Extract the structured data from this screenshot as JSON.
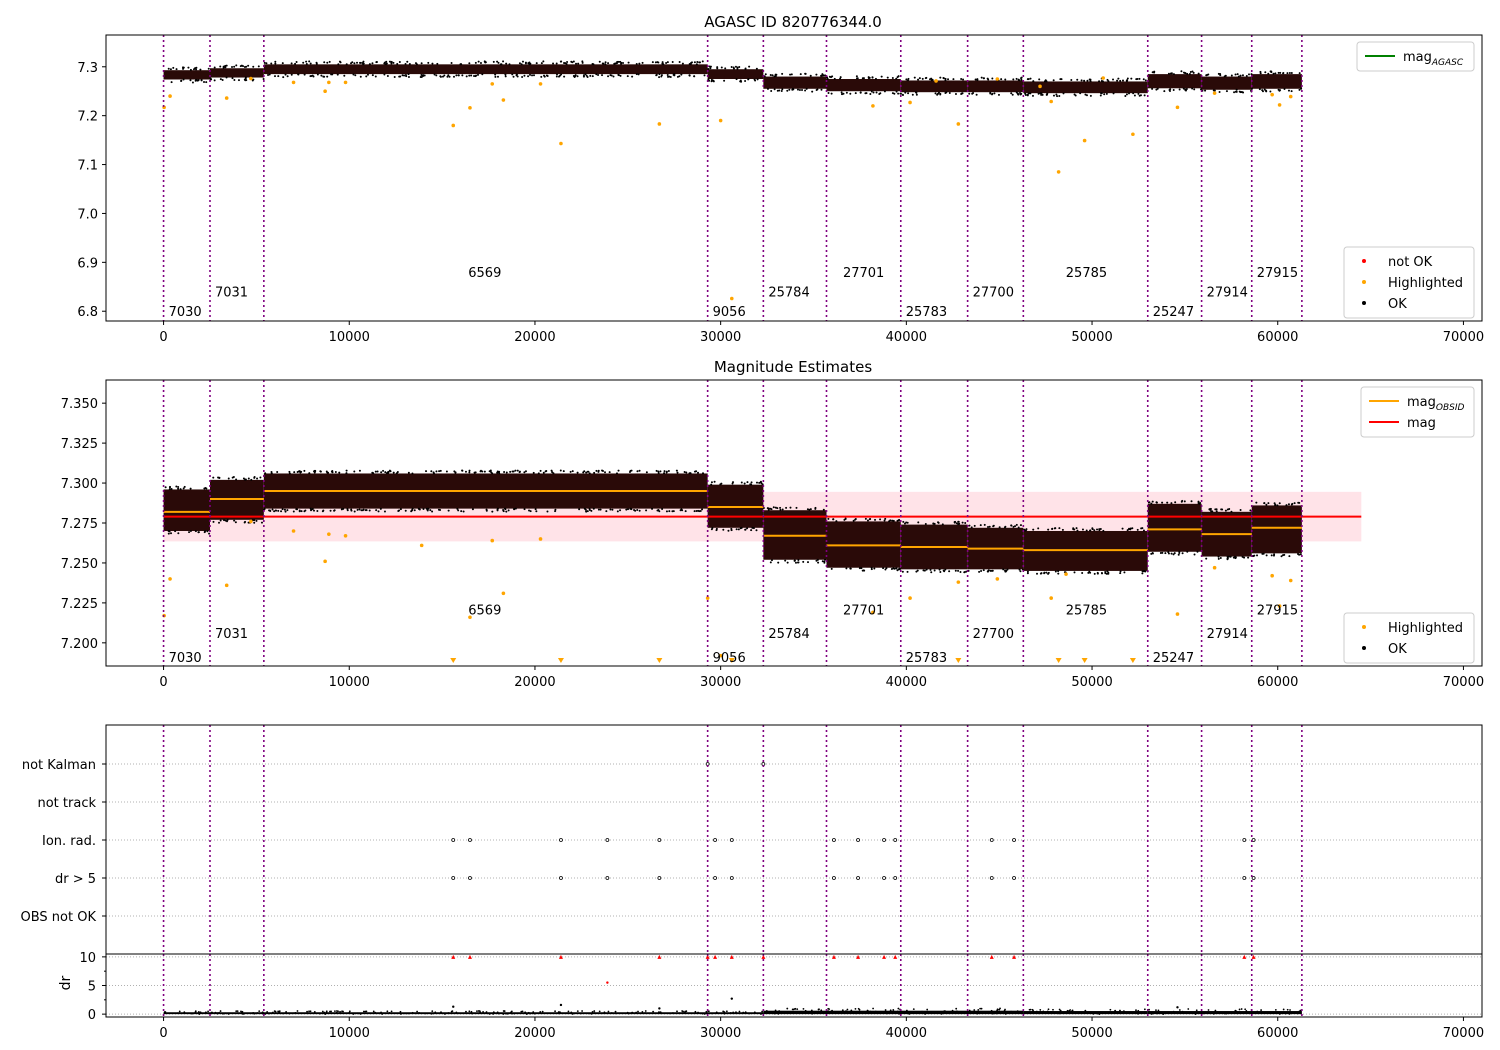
{
  "colors": {
    "ok": "#000000",
    "highlighted": "#ffa500",
    "not_ok": "#ff0000",
    "mag_agasc": "#008000",
    "mag_obsid": "#ffa500",
    "mag": "#ff0000",
    "band": "#ffc0cb",
    "obs_boundary": "#800080",
    "ok_band_fill": "#2a0a08"
  },
  "obsids": [
    {
      "label": "7030",
      "start": 0,
      "end": 2500,
      "level": 0
    },
    {
      "label": "7031",
      "start": 2500,
      "end": 5400,
      "level": 1
    },
    {
      "label": "6569",
      "start": 5400,
      "end": 29300,
      "level": 2
    },
    {
      "label": "9056",
      "start": 29300,
      "end": 32300,
      "level": 0
    },
    {
      "label": "25784",
      "start": 32300,
      "end": 35700,
      "level": 1
    },
    {
      "label": "27701",
      "start": 35700,
      "end": 39700,
      "level": 2
    },
    {
      "label": "25783",
      "start": 39700,
      "end": 43300,
      "level": 0
    },
    {
      "label": "27700",
      "start": 43300,
      "end": 46300,
      "level": 1
    },
    {
      "label": "25785",
      "start": 46300,
      "end": 53000,
      "level": 2
    },
    {
      "label": "25247",
      "start": 53000,
      "end": 55900,
      "level": 0
    },
    {
      "label": "27914",
      "start": 55900,
      "end": 58600,
      "level": 1
    },
    {
      "label": "27915",
      "start": 58600,
      "end": 61300,
      "level": 2
    }
  ],
  "chart_data": [
    {
      "type": "scatter",
      "title": "AGASC ID 820776344.0",
      "xlim": [
        -3100,
        71000
      ],
      "ylim": [
        6.78,
        7.365
      ],
      "xticks": [
        0,
        10000,
        20000,
        30000,
        40000,
        50000,
        60000,
        70000
      ],
      "xtick_labels": [
        "0",
        "10000",
        "20000",
        "30000",
        "40000",
        "50000",
        "60000",
        "70000"
      ],
      "yticks": [
        6.8,
        6.9,
        7.0,
        7.1,
        7.2,
        7.3
      ],
      "ytick_labels": [
        "6.8",
        "6.9",
        "7.0",
        "7.1",
        "7.2",
        "7.3"
      ],
      "ok_band": [
        {
          "start": 0,
          "end": 2500,
          "lo": 7.274,
          "hi": 7.293
        },
        {
          "start": 2500,
          "end": 5400,
          "lo": 7.278,
          "hi": 7.297
        },
        {
          "start": 5400,
          "end": 29300,
          "lo": 7.285,
          "hi": 7.305
        },
        {
          "start": 29300,
          "end": 32300,
          "lo": 7.275,
          "hi": 7.295
        },
        {
          "start": 32300,
          "end": 35700,
          "lo": 7.255,
          "hi": 7.28
        },
        {
          "start": 35700,
          "end": 39700,
          "lo": 7.25,
          "hi": 7.275
        },
        {
          "start": 39700,
          "end": 43300,
          "lo": 7.248,
          "hi": 7.272
        },
        {
          "start": 43300,
          "end": 46300,
          "lo": 7.248,
          "hi": 7.272
        },
        {
          "start": 46300,
          "end": 53000,
          "lo": 7.246,
          "hi": 7.27
        },
        {
          "start": 53000,
          "end": 55900,
          "lo": 7.256,
          "hi": 7.285
        },
        {
          "start": 55900,
          "end": 58600,
          "lo": 7.253,
          "hi": 7.28
        },
        {
          "start": 58600,
          "end": 61300,
          "lo": 7.255,
          "hi": 7.285
        }
      ],
      "highlighted_points": [
        [
          30,
          7.217
        ],
        [
          350,
          7.24
        ],
        [
          3400,
          7.236
        ],
        [
          4700,
          7.276
        ],
        [
          7000,
          7.268
        ],
        [
          8700,
          7.25
        ],
        [
          8900,
          7.268
        ],
        [
          9800,
          7.268
        ],
        [
          15600,
          7.18
        ],
        [
          16500,
          7.216
        ],
        [
          17700,
          7.265
        ],
        [
          18300,
          7.232
        ],
        [
          20300,
          7.265
        ],
        [
          21400,
          7.143
        ],
        [
          26700,
          7.183
        ],
        [
          30000,
          7.19
        ],
        [
          30600,
          6.826
        ],
        [
          38200,
          7.22
        ],
        [
          40200,
          7.227
        ],
        [
          41600,
          7.271
        ],
        [
          42800,
          7.183
        ],
        [
          44900,
          7.275
        ],
        [
          47200,
          7.26
        ],
        [
          47800,
          7.229
        ],
        [
          48200,
          7.085
        ],
        [
          49600,
          7.149
        ],
        [
          50600,
          7.277
        ],
        [
          52200,
          7.162
        ],
        [
          54600,
          7.217
        ],
        [
          56600,
          7.246
        ],
        [
          59700,
          7.243
        ],
        [
          60100,
          7.222
        ],
        [
          60700,
          7.239
        ]
      ],
      "legend_upper": {
        "location": "upper right",
        "entries": [
          {
            "label": "mag",
            "subscript": "AGASC",
            "color": "mag_agasc"
          }
        ]
      },
      "legend_lower": {
        "location": "lower right",
        "entries": [
          {
            "label": "not OK",
            "color": "not_ok"
          },
          {
            "label": "Highlighted",
            "color": "highlighted"
          },
          {
            "label": "OK",
            "color": "ok"
          }
        ]
      },
      "obsid_label_y": [
        6.8,
        6.84,
        6.88
      ]
    },
    {
      "type": "scatter",
      "title": "Magnitude Estimates",
      "xlim": [
        -3100,
        71000
      ],
      "ylim": [
        7.1855,
        7.3645
      ],
      "xticks": [
        0,
        10000,
        20000,
        30000,
        40000,
        50000,
        60000,
        70000
      ],
      "xtick_labels": [
        "0",
        "10000",
        "20000",
        "30000",
        "40000",
        "50000",
        "60000",
        "70000"
      ],
      "yticks": [
        7.2,
        7.225,
        7.25,
        7.275,
        7.3,
        7.325,
        7.35
      ],
      "ytick_labels": [
        "7.200",
        "7.225",
        "7.250",
        "7.275",
        "7.300",
        "7.325",
        "7.350"
      ],
      "mag": 7.279,
      "mag_band": [
        7.2635,
        7.2945
      ],
      "mag_extent": [
        0,
        64500
      ],
      "mag_obsid": [
        7.282,
        7.29,
        7.295,
        7.285,
        7.267,
        7.261,
        7.26,
        7.259,
        7.258,
        7.271,
        7.268,
        7.272
      ],
      "ok_band": [
        {
          "start": 0,
          "end": 2500,
          "lo": 7.27,
          "hi": 7.296
        },
        {
          "start": 2500,
          "end": 5400,
          "lo": 7.277,
          "hi": 7.302
        },
        {
          "start": 5400,
          "end": 29300,
          "lo": 7.284,
          "hi": 7.306
        },
        {
          "start": 29300,
          "end": 32300,
          "lo": 7.272,
          "hi": 7.299
        },
        {
          "start": 32300,
          "end": 35700,
          "lo": 7.252,
          "hi": 7.283
        },
        {
          "start": 35700,
          "end": 39700,
          "lo": 7.247,
          "hi": 7.276
        },
        {
          "start": 39700,
          "end": 43300,
          "lo": 7.246,
          "hi": 7.274
        },
        {
          "start": 43300,
          "end": 46300,
          "lo": 7.246,
          "hi": 7.272
        },
        {
          "start": 46300,
          "end": 53000,
          "lo": 7.245,
          "hi": 7.27
        },
        {
          "start": 53000,
          "end": 55900,
          "lo": 7.257,
          "hi": 7.287
        },
        {
          "start": 55900,
          "end": 58600,
          "lo": 7.254,
          "hi": 7.282
        },
        {
          "start": 58600,
          "end": 61300,
          "lo": 7.256,
          "hi": 7.286
        }
      ],
      "highlighted_points": [
        [
          30,
          7.217
        ],
        [
          350,
          7.24
        ],
        [
          3400,
          7.236
        ],
        [
          4700,
          7.276
        ],
        [
          7000,
          7.27
        ],
        [
          8700,
          7.251
        ],
        [
          8900,
          7.268
        ],
        [
          9800,
          7.267
        ],
        [
          13900,
          7.261
        ],
        [
          16500,
          7.216
        ],
        [
          17700,
          7.264
        ],
        [
          18300,
          7.231
        ],
        [
          20300,
          7.265
        ],
        [
          29300,
          7.228
        ],
        [
          30000,
          7.192
        ],
        [
          38200,
          7.219
        ],
        [
          40200,
          7.228
        ],
        [
          42800,
          7.238
        ],
        [
          44900,
          7.24
        ],
        [
          47800,
          7.228
        ],
        [
          48600,
          7.243
        ],
        [
          54600,
          7.218
        ],
        [
          56600,
          7.247
        ],
        [
          59700,
          7.242
        ],
        [
          60100,
          7.223
        ],
        [
          60700,
          7.239
        ]
      ],
      "below_range_points": [
        15600,
        21400,
        26700,
        30600,
        42800,
        48200,
        49600,
        52200
      ],
      "legend_upper": {
        "location": "upper right",
        "entries": [
          {
            "label": "mag",
            "subscript": "OBSID",
            "color": "mag_obsid"
          },
          {
            "label": "mag",
            "color": "mag"
          }
        ]
      },
      "legend_lower": {
        "location": "lower right",
        "entries": [
          {
            "label": "Highlighted",
            "color": "highlighted"
          },
          {
            "label": "OK",
            "color": "ok"
          }
        ]
      },
      "obsid_label_y": [
        7.191,
        7.206,
        7.221
      ]
    },
    {
      "type": "scatter",
      "title": "",
      "flag_rows": [
        "not Kalman",
        "not track",
        "Ion. rad.",
        "dr > 5",
        "OBS not OK"
      ],
      "flag_points": {
        "not Kalman": [
          29300,
          32300
        ],
        "not track": [],
        "Ion. rad.": [
          15600,
          16500,
          21400,
          23900,
          26700,
          29700,
          30600,
          36100,
          37400,
          38800,
          39400,
          44600,
          45800,
          58200,
          58700
        ],
        "dr > 5": [
          15600,
          16500,
          21400,
          23900,
          26700,
          29700,
          30600,
          36100,
          37400,
          38800,
          39400,
          44600,
          45800,
          58200,
          58700
        ],
        "OBS not OK": []
      },
      "dr": {
        "ylabel": "dr",
        "ylim": [
          -0.5,
          10.5
        ],
        "yticks": [
          0,
          5,
          10
        ],
        "ytick_labels": [
          "0",
          "5",
          "10"
        ],
        "capped_points": [
          15600,
          16500,
          21400,
          26700,
          29300,
          29700,
          30600,
          32300,
          36100,
          37400,
          38800,
          39400,
          44600,
          45800,
          58200,
          58700
        ],
        "outlier_points": [
          [
            23900,
            5.5
          ],
          [
            30600,
            2.7
          ],
          [
            21400,
            1.6
          ],
          [
            15600,
            1.3
          ],
          [
            54600,
            1.2
          ],
          [
            26700,
            1.0
          ]
        ],
        "noise_band": [
          {
            "start": 0,
            "end": 32300,
            "hi": 0.55
          },
          {
            "start": 32300,
            "end": 46300,
            "hi": 1.0
          },
          {
            "start": 46300,
            "end": 53000,
            "hi": 0.9
          },
          {
            "start": 53000,
            "end": 61300,
            "hi": 0.9
          }
        ]
      },
      "xlim": [
        -3100,
        71000
      ],
      "xticks": [
        0,
        10000,
        20000,
        30000,
        40000,
        50000,
        60000,
        70000
      ],
      "xtick_labels": [
        "0",
        "10000",
        "20000",
        "30000",
        "40000",
        "50000",
        "60000",
        "70000"
      ]
    }
  ]
}
